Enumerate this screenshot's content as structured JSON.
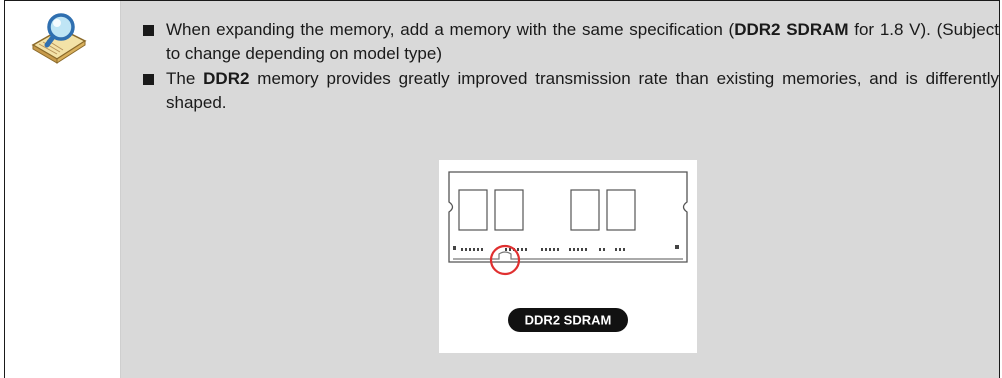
{
  "note": {
    "icon": "book-magnifier-icon",
    "bullets": [
      {
        "parts": [
          {
            "text": "When expanding the memory, add a memory with the same specification (",
            "bold": false
          },
          {
            "text": "DDR2 SDRAM",
            "bold": true
          },
          {
            "text": " for 1.8 V). (Subject to change depending on model type)",
            "bold": false
          }
        ]
      },
      {
        "parts": [
          {
            "text": "The ",
            "bold": false
          },
          {
            "text": "DDR2",
            "bold": true
          },
          {
            "text": " memory provides greatly improved transmission rate than existing memories, and is differently shaped.",
            "bold": false
          }
        ]
      }
    ]
  },
  "figure": {
    "badge_label": "DDR2 SDRAM",
    "highlight_color": "#e03030"
  }
}
